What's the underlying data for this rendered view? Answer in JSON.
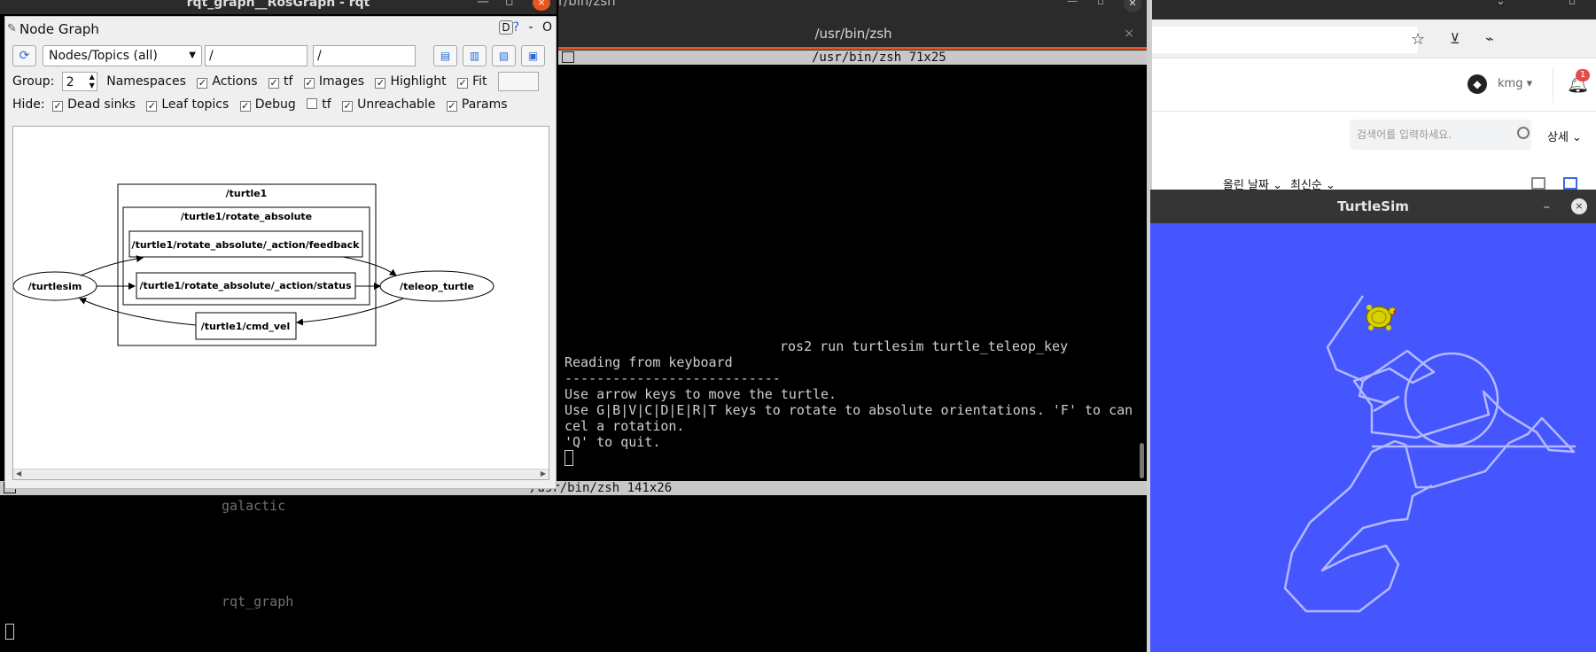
{
  "terminal": {
    "window_title": "/usr/bin/zsh",
    "top_title_fragment": "r/bin/zsh",
    "tab_title": "/usr/bin/zsh",
    "tab_close": "×",
    "pane_top_header": "/usr/bin/zsh 71x25",
    "pane_bottom_header": "/usr/bin/zsh 141x26",
    "pane_top_lines": {
      "line0": "ros2 run turtlesim turtle_teleop_key",
      "line1": "Reading from keyboard",
      "line2": "---------------------------",
      "line3": "Use arrow keys to move the turtle.",
      "line4": "Use G|B|V|C|D|E|R|T keys to rotate to absolute orientations. 'F' to can",
      "line5": "cel a rotation.",
      "line6": "'Q' to quit."
    },
    "pane_bottom_lines": {
      "line0": "galactic",
      "line1": "rqt_graph"
    }
  },
  "rqt": {
    "outer_title": "rqt_graph__RosGraph - rqt",
    "outer_close": "×",
    "plugin_title": "Node Graph",
    "title_buttons": {
      "d": "D",
      "help": "?",
      "dash": "-",
      "o": "O"
    },
    "toolbar": {
      "refresh_icon": "⟳",
      "mode_combo": "Nodes/Topics (all)",
      "node_filter": "/",
      "topic_filter": "/"
    },
    "group": {
      "label": "Group:",
      "value": "2"
    },
    "options_row": {
      "namespaces": "Namespaces",
      "actions": "Actions",
      "tf": "tf",
      "images": "Images",
      "highlight": "Highlight",
      "fit": "Fit"
    },
    "hide_row": {
      "label": "Hide:",
      "dead_sinks": "Dead sinks",
      "leaf_topics": "Leaf topics",
      "debug": "Debug",
      "tf": "tf",
      "unreachable": "Unreachable",
      "params": "Params"
    },
    "checks": {
      "actions": true,
      "tf": true,
      "images": true,
      "highlight": true,
      "fit": true,
      "dead_sinks": true,
      "leaf_topics": true,
      "debug": true,
      "hide_tf": false,
      "unreachable": true,
      "params": true
    },
    "graph": {
      "group_outer": "/turtle1",
      "group_inner": "/turtle1/rotate_absolute",
      "topic_feedback": "/turtle1/rotate_absolute/_action/feedback",
      "topic_status": "/turtle1/rotate_absolute/_action/status",
      "topic_cmd_vel": "/turtle1/cmd_vel",
      "node_turtlesim": "/turtlesim",
      "node_teleop": "/teleop_turtle"
    }
  },
  "browser": {
    "user": "kmg",
    "notification_count": "1",
    "search_placeholder": "검색어를 입력하세요.",
    "detail_label": "상세",
    "sort_date": "올린 날짜",
    "sort_latest": "최신순"
  },
  "turtlesim": {
    "title": "TurtleSim",
    "min": "–",
    "close": "×",
    "background_color": "#4556ff",
    "pen_color": "#b3b8ff"
  }
}
